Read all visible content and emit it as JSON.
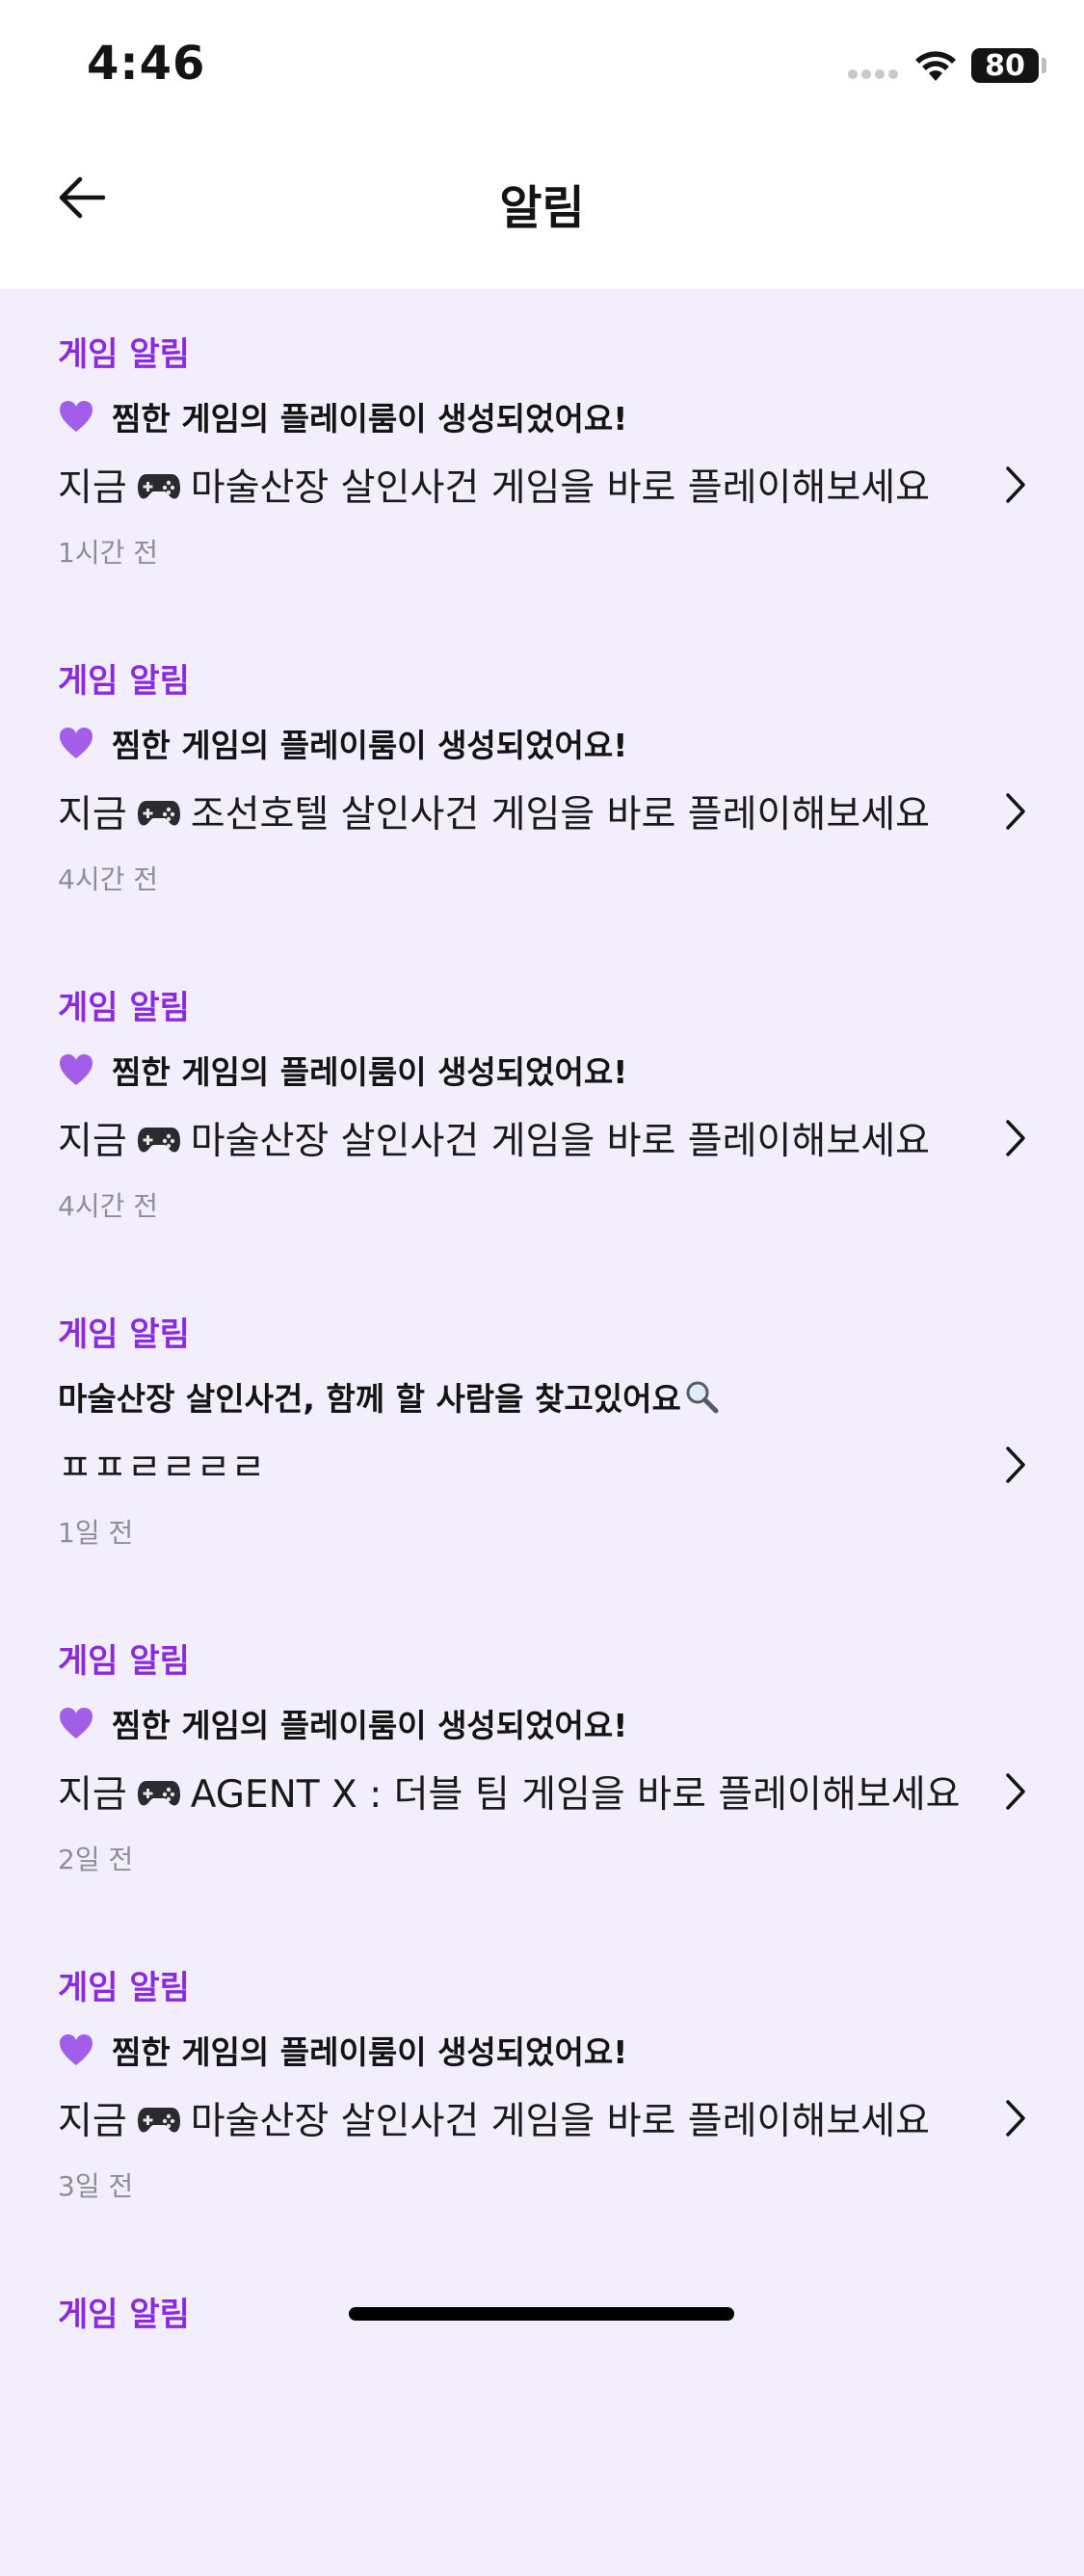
{
  "status_bar": {
    "time": "4:46",
    "battery": "80"
  },
  "header": {
    "title": "알림"
  },
  "notifications": [
    {
      "category": "게임 알림",
      "headline": "찜한 게임의 플레이룸이 생성되었어요!",
      "message_prefix": "지금",
      "message_game": "마술산장 살인사건 게임을 바로 플레이해보세요",
      "time": "1시간 전"
    },
    {
      "category": "게임 알림",
      "headline": "찜한 게임의 플레이룸이 생성되었어요!",
      "message_prefix": "지금",
      "message_game": "조선호텔 살인사건 게임을 바로 플레이해보세요",
      "time": "4시간 전"
    },
    {
      "category": "게임 알림",
      "headline": "찜한 게임의 플레이룸이 생성되었어요!",
      "message_prefix": "지금",
      "message_game": "마술산장 살인사건 게임을 바로 플레이해보세요",
      "time": "4시간 전"
    },
    {
      "category": "게임 알림",
      "headline": "마술산장 살인사건, 함께 할 사람을 찾고있어요",
      "message": "ㅍㅍㄹㄹㄹㄹ",
      "time": "1일 전"
    },
    {
      "category": "게임 알림",
      "headline": "찜한 게임의 플레이룸이 생성되었어요!",
      "message_prefix": "지금",
      "message_game": "AGENT X : 더블 팀 게임을 바로 플레이해보세요",
      "time": "2일 전"
    },
    {
      "category": "게임 알림",
      "headline": "찜한 게임의 플레이룸이 생성되었어요!",
      "message_prefix": "지금",
      "message_game": "마술산장 살인사건 게임을 바로 플레이해보세요",
      "time": "3일 전"
    },
    {
      "category": "게임 알림"
    }
  ],
  "icons": {
    "back": "arrow-left-icon",
    "heart": "purple-heart-icon",
    "game": "game-controller-icon",
    "search": "magnifying-glass-icon",
    "chevron": "chevron-right-icon"
  },
  "colors": {
    "accent": "#8a2be2",
    "background": "#f2eefc",
    "heart": "#a25ee8",
    "muted": "#8e8e93"
  }
}
